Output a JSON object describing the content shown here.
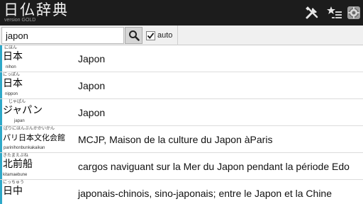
{
  "app": {
    "title": "日仏辞典",
    "version": "version GOLD"
  },
  "toolbar": {
    "icons": [
      "tools-icon",
      "favorites-list-icon",
      "settings-icon"
    ]
  },
  "search": {
    "value": "japon",
    "auto_label": "auto",
    "auto_checked": true
  },
  "colors": {
    "titlebar": "#1c1c1c",
    "accent": "#2ea8c8",
    "row_border": "#dcdcdc"
  },
  "results": [
    {
      "reading": "にほん",
      "word": "日本",
      "romaji": "nihon",
      "translation": "Japon"
    },
    {
      "reading": "にっぽん",
      "word": "日本",
      "romaji": "nippon",
      "translation": "Japon"
    },
    {
      "reading": "じゃぱん",
      "word": "ジャパン",
      "romaji": "japan",
      "translation": "Japon"
    },
    {
      "reading": "ぱりにほんぶんかかいかん",
      "word": "パリ日本文化会館",
      "romaji": "parinihonbunkakaikan",
      "translation": "MCJP, Maison de la culture du Japon àParis"
    },
    {
      "reading": "きたまえぶね",
      "word": "北前船",
      "romaji": "kitamaebune",
      "translation": "cargos naviguant sur la Mer du Japon pendant la période Edo"
    },
    {
      "reading": "にっちゅう",
      "word": "日中",
      "romaji": "",
      "translation": "japonais-chinois, sino-japonais; entre le Japon et la Chine"
    }
  ]
}
